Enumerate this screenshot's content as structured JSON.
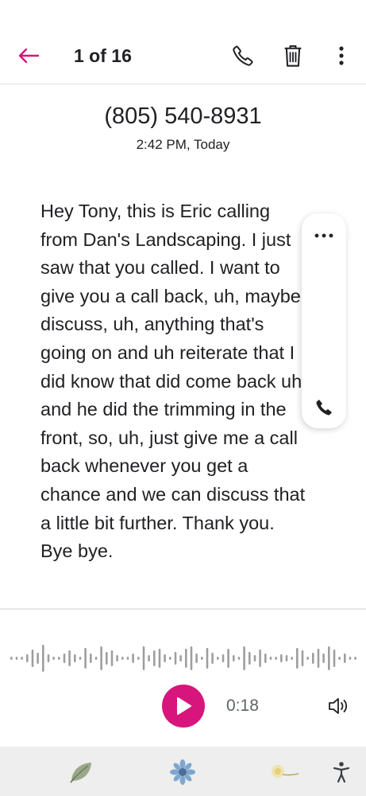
{
  "header": {
    "back_icon": "arrow-left-icon",
    "counter": "1 of 16",
    "call_icon": "phone-icon",
    "delete_icon": "trash-icon",
    "more_icon": "more-vert-icon"
  },
  "voicemail": {
    "phone_number": "(805) 540-8931",
    "timestamp": "2:42 PM, Today",
    "transcript": "Hey Tony, this is Eric calling from Dan's Landscaping. I just saw that you called. I want to give you a call back, uh, maybe discuss, uh, anything that's going on and uh reiterate that I did know that did come back uh, and he did the trimming in the front, so, uh, just give me a call back whenever you get a chance and we can discuss that a little bit further. Thank you. Bye bye."
  },
  "floating_panel": {
    "more_icon": "more-horiz-icon",
    "call_icon": "phone-icon"
  },
  "player": {
    "waveform_icon": "waveform-icon",
    "play_icon": "play-icon",
    "duration": "0:18",
    "volume_icon": "volume-icon"
  },
  "nav": {
    "items": [
      "leaf-icon",
      "blue-flower-icon",
      "dandelion-icon",
      "accessibility-icon"
    ]
  },
  "colors": {
    "accent": "#d8157d",
    "text": "#202124",
    "secondary_text": "#5f6368",
    "navbar_bg": "#eeeeee"
  }
}
